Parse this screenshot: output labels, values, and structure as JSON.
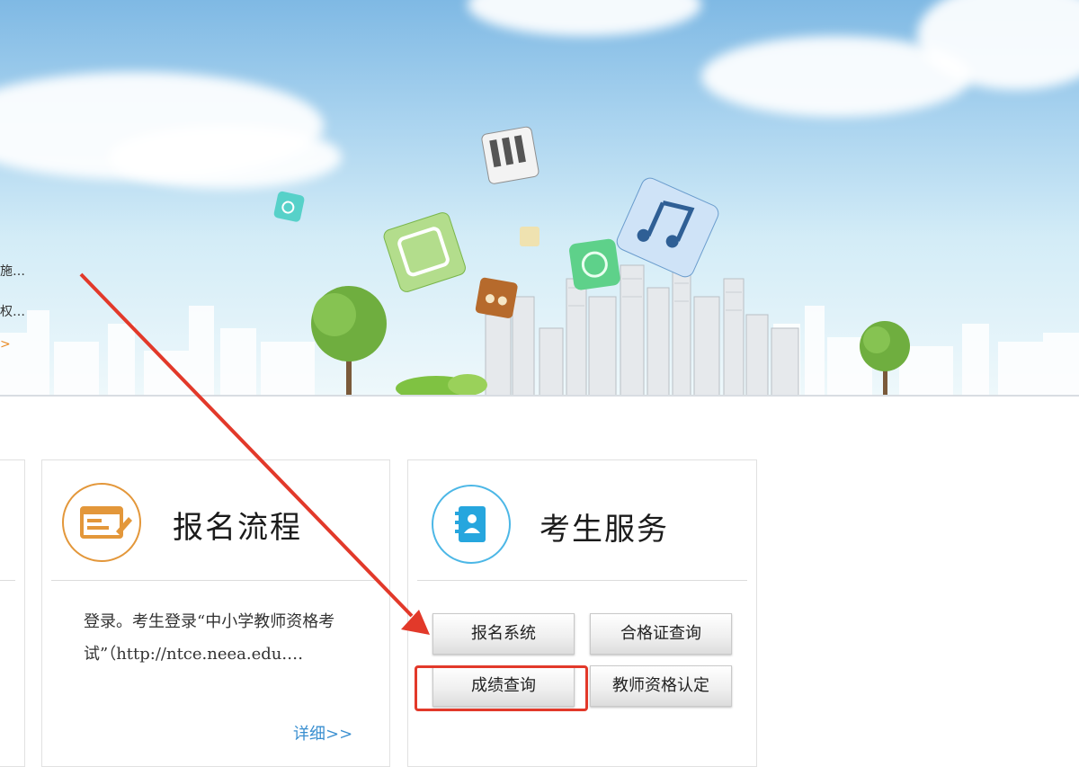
{
  "banner": {
    "side_text_1": "施…",
    "side_text_2": "权…",
    "side_link": ">"
  },
  "card_registration": {
    "title": "报名流程",
    "icon": "form-edit-icon",
    "description": "登录。考生登录“中小学教师资格考试”（http://ntce.neea.edu.…",
    "more_link": "详细>>"
  },
  "card_services": {
    "title": "考生服务",
    "icon": "address-book-icon",
    "buttons": {
      "registration_system": "报名系统",
      "certificate_query": "合格证查询",
      "score_query": "成绩查询",
      "teacher_qualification": "教师资格认定"
    }
  },
  "annotation": {
    "arrow_color": "#e2392a",
    "highlight_color": "#e2392a"
  }
}
